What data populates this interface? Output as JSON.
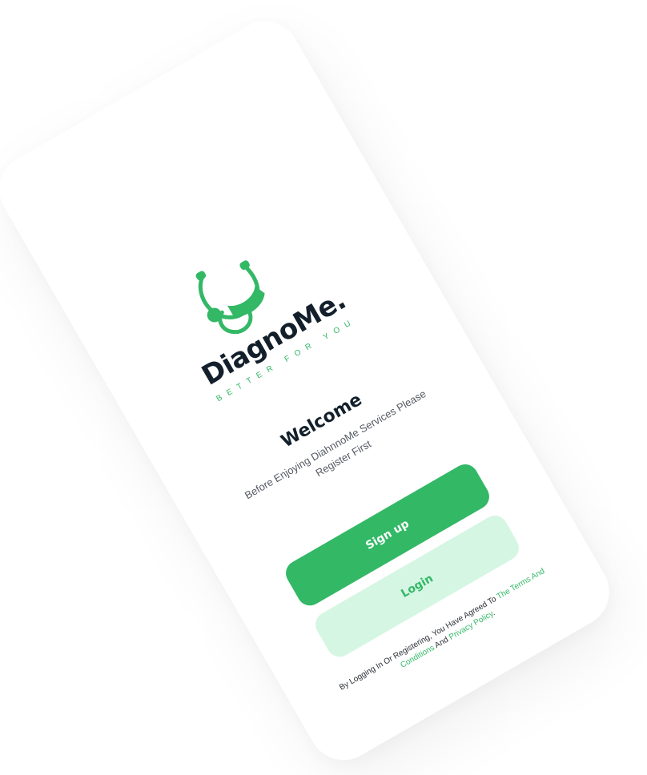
{
  "brand": {
    "name": "DiagnoMe.",
    "tagline": "BETTER FOR YOU",
    "accent_color": "#33b866",
    "dark_color": "#13202b",
    "logo_icon": "stethoscope-icon"
  },
  "welcome": {
    "title": "Welcome",
    "subtitle": "Before Enjoying DiahnnoMe Services Please Register First"
  },
  "actions": {
    "signup_label": "Sign up",
    "login_label": "Login"
  },
  "legal": {
    "prefix": "By Logging In Or Registering, You Have Agreed To ",
    "terms_link": "The Terms And Conditions",
    "middle": " And ",
    "privacy_link": "Privacy Policy",
    "suffix": "."
  }
}
